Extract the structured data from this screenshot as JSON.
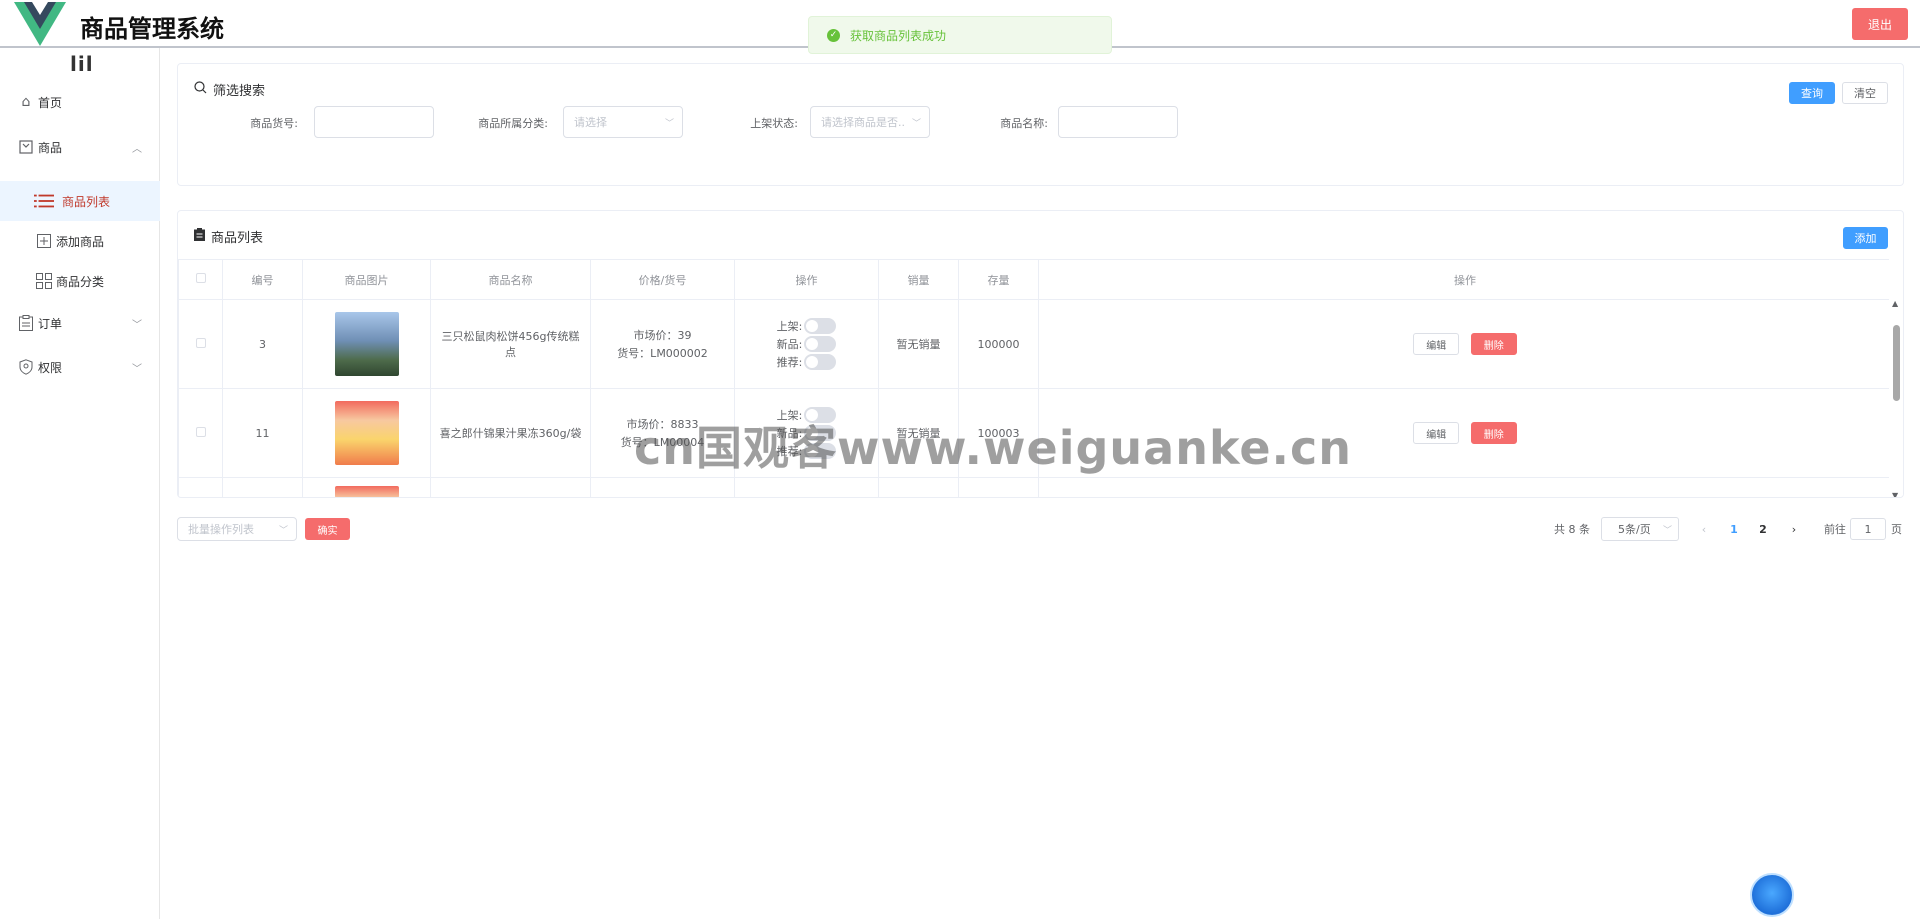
{
  "header": {
    "title": "商品管理系统",
    "logout_label": "退出"
  },
  "toast": {
    "message": "获取商品列表成功"
  },
  "sidebar": {
    "toggle": "lil",
    "items": [
      {
        "label": "首页",
        "icon": "home-icon"
      },
      {
        "label": "商品",
        "icon": "product-icon"
      },
      {
        "label": "订单",
        "icon": "order-icon"
      },
      {
        "label": "权限",
        "icon": "permission-icon"
      }
    ],
    "sub_items": [
      {
        "label": "商品列表",
        "icon": "list-icon",
        "active": true
      },
      {
        "label": "添加商品",
        "icon": "add-icon",
        "active": false
      },
      {
        "label": "商品分类",
        "icon": "category-icon",
        "active": false
      }
    ]
  },
  "search": {
    "title": "筛选搜索",
    "query_label": "查询",
    "clear_label": "清空",
    "fields": {
      "sku_label": "商品货号:",
      "category_label": "商品所属分类:",
      "category_placeholder": "请选择",
      "status_label": "上架状态:",
      "status_placeholder": "请选择商品是否..",
      "name_label": "商品名称:"
    }
  },
  "list": {
    "title": "商品列表",
    "add_label": "添加",
    "columns": [
      "编号",
      "商品图片",
      "商品名称",
      "价格/货号",
      "操作",
      "销量",
      "存量",
      "操作"
    ],
    "rows": [
      {
        "id": "3",
        "name": "三只松鼠肉松饼456g传统糕点",
        "price": "市场价：39",
        "sku": "货号：LM000002",
        "sales": "暂无销量",
        "stock": "100000"
      },
      {
        "id": "11",
        "name": "喜之郎什锦果汁果冻360g/袋",
        "price": "市场价：8833",
        "sku": "货号：LM00004",
        "sales": "暂无销量",
        "stock": "100003"
      }
    ],
    "switch_labels": {
      "on_shelf": "上架:",
      "new": "新品:",
      "recommend": "推荐:"
    },
    "edit_label": "编辑",
    "delete_label": "删除"
  },
  "footer": {
    "batch_placeholder": "批量操作列表",
    "confirm_label": "确实",
    "total": "共 8 条",
    "page_size": "5条/页",
    "pages": [
      "1",
      "2"
    ],
    "goto_prefix": "前往",
    "goto_value": "1",
    "goto_suffix": "页"
  },
  "watermark": "cn国观客www.weiguanke.cn",
  "colors": {
    "primary": "#409eff",
    "danger": "#f56c6c",
    "success": "#67c23a",
    "active_text": "#c0392b"
  }
}
